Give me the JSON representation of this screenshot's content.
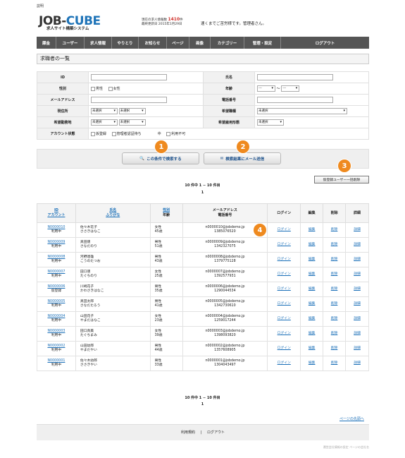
{
  "top_label": "説明",
  "logo": {
    "part1": "JOB-",
    "part2": "CUBE",
    "subtitle": "求人サイト構築システム"
  },
  "stats": {
    "line1_prefix": "現在の求人情報数",
    "count": "1410",
    "line1_suffix": "件",
    "line2": "最終更新日 2015年1月29日"
  },
  "welcome": "速くまでご苦労様です。管理者さん。",
  "nav": [
    "課金",
    "ユーザー",
    "求人情報",
    "やりとり",
    "お知らせ",
    "ページ",
    "画像",
    "カテゴリー",
    "管理・設定",
    "ログアウト"
  ],
  "section_title": "求職者の一覧",
  "search": {
    "id_label": "ID",
    "name_label": "氏名",
    "gender_label": "性別",
    "gender_male": "男性",
    "gender_female": "女性",
    "age_label": "年齢",
    "age_from": "---",
    "age_sep": "〜",
    "age_to": "---",
    "email_label": "メールアドレス",
    "phone_label": "電話番号",
    "address_label": "現住所",
    "address_sel1": "未選択",
    "address_sel2": "未選択",
    "job_label": "希望職種",
    "job_sel": "未選択",
    "workplace_label": "希望勤務地",
    "workplace_sel1": "未選択",
    "workplace_sel2": "未選択",
    "employment_label": "希望雇用形態",
    "employment_sel": "未選択",
    "status_label": "アカウント状態",
    "status_opt1": "仮登録",
    "status_opt2": "管理者認証待ち",
    "status_opt3": "中",
    "status_opt4": "利用不可",
    "search_button": "この条件で検索する",
    "mail_button": "検索結果にメール送信"
  },
  "badges": [
    "1",
    "2",
    "3",
    "4"
  ],
  "bulk_delete_button": "仮登録ユーザー一括削除",
  "pager": {
    "summary": "10 件中 1 − 10 件目",
    "page": "1"
  },
  "table": {
    "headers": {
      "id": "ID",
      "account": "アカウント",
      "name": "氏名",
      "kana": "ふりがな",
      "gender": "性別",
      "age": "年齢",
      "email": "メールアドレス",
      "phone": "電話番号",
      "login": "ログイン",
      "edit": "編集",
      "delete": "削除",
      "detail": "詳細"
    },
    "rows": [
      {
        "id": "N0000010",
        "status": "利用中",
        "name": "佐々木花子",
        "kana": "ささきはなこ",
        "gender": "女性",
        "age": "45歳",
        "email": "n0000010@jobdemo.jp",
        "phone": "1385076520",
        "login": "ログイン",
        "edit": "編集",
        "delete": "削除",
        "detail": "詳細"
      },
      {
        "id": "N0000009",
        "status": "利用中",
        "name": "真田徳",
        "kana": "さなだのり",
        "gender": "男性",
        "age": "51歳",
        "email": "n0000009@jobdemo.jp",
        "phone": "1342327075",
        "login": "ログイン",
        "edit": "編集",
        "delete": "削除",
        "detail": "詳細"
      },
      {
        "id": "N0000008",
        "status": "利用中",
        "name": "河野達雄",
        "kana": "こうのたつお",
        "gender": "男性",
        "age": "43歳",
        "email": "n0000008@jobdemo.jp",
        "phone": "1379775128",
        "login": "ログイン",
        "edit": "編集",
        "delete": "削除",
        "detail": "詳細"
      },
      {
        "id": "N0000007",
        "status": "利用中",
        "name": "田口徳",
        "kana": "たぐちのり",
        "gender": "女性",
        "age": "25歳",
        "email": "n0000007@jobdemo.jp",
        "phone": "1392577931",
        "login": "ログイン",
        "edit": "編集",
        "delete": "削除",
        "detail": "詳細"
      },
      {
        "id": "N0000006",
        "status": "仮登録",
        "name": "川崎花子",
        "kana": "かわさきはなこ",
        "gender": "男性",
        "age": "35歳",
        "email": "n0000006@jobdemo.jp",
        "phone": "1290044534",
        "login": "ログイン",
        "edit": "編集",
        "delete": "削除",
        "detail": "詳細"
      },
      {
        "id": "N0000005",
        "status": "利用中",
        "name": "真田太郎",
        "kana": "さなだたろう",
        "gender": "男性",
        "age": "41歳",
        "email": "n0000005@jobdemo.jp",
        "phone": "1342730610",
        "login": "ログイン",
        "edit": "編集",
        "delete": "削除",
        "detail": "詳細"
      },
      {
        "id": "N0000004",
        "status": "利用中",
        "name": "山田花子",
        "kana": "やまだはなこ",
        "gender": "女性",
        "age": "23歳",
        "email": "n0000004@jobdemo.jp",
        "phone": "1259017244",
        "login": "ログイン",
        "edit": "編集",
        "delete": "削除",
        "detail": "詳細"
      },
      {
        "id": "N0000003",
        "status": "利用中",
        "name": "田口真美",
        "kana": "たぐちまみ",
        "gender": "女性",
        "age": "39歳",
        "email": "n0000003@jobdemo.jp",
        "phone": "1398093820",
        "login": "ログイン",
        "edit": "編集",
        "delete": "削除",
        "detail": "詳細"
      },
      {
        "id": "N0000002",
        "status": "利用中",
        "name": "山田幼郎",
        "kana": "やまだやい",
        "gender": "男性",
        "age": "44歳",
        "email": "n0000002@jobdemo.jp",
        "phone": "1357608905",
        "login": "ログイン",
        "edit": "編集",
        "delete": "削除",
        "detail": "詳細"
      },
      {
        "id": "N0000001",
        "status": "利用中",
        "name": "佐々木幼郎",
        "kana": "ささきやい",
        "gender": "男性",
        "age": "33歳",
        "email": "n0000001@jobdemo.jp",
        "phone": "1304043497",
        "login": "ログイン",
        "edit": "編集",
        "delete": "削除",
        "detail": "詳細"
      }
    ]
  },
  "next_page_link": "ページの先頭へ",
  "footer": {
    "terms": "利用規約",
    "sep": "|",
    "logout": "ログアウト"
  },
  "copyright": "運営会社情報の設定 ページの会社名"
}
